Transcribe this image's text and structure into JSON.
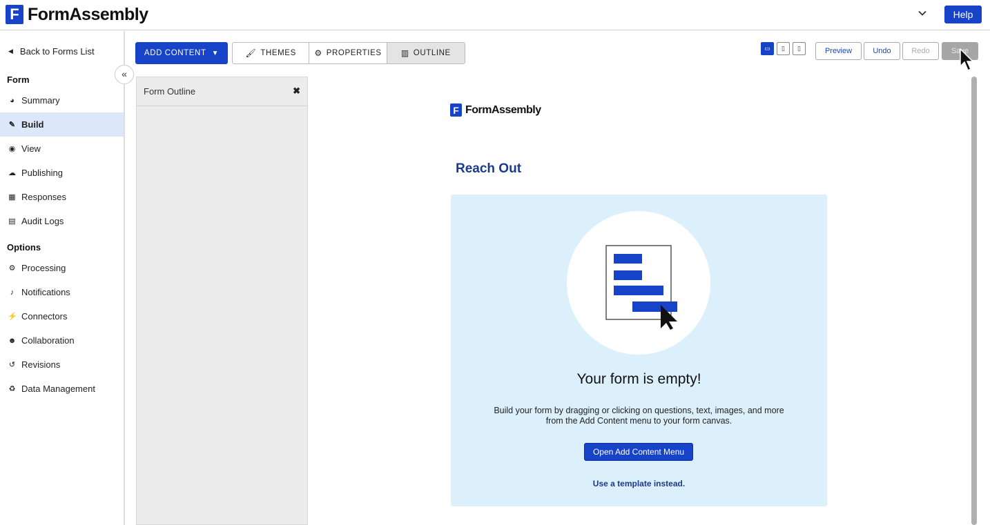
{
  "app": {
    "logo_letter": "F",
    "name": "FormAssembly",
    "help_label": "Help"
  },
  "sidebar": {
    "back_label": "Back to Forms List",
    "form_heading": "Form",
    "form_items": [
      {
        "label": "Summary",
        "icon": "dashboard-icon"
      },
      {
        "label": "Build",
        "icon": "pencil-icon",
        "active": true
      },
      {
        "label": "View",
        "icon": "eye-icon"
      },
      {
        "label": "Publishing",
        "icon": "cloud-upload-icon"
      },
      {
        "label": "Responses",
        "icon": "table-icon"
      },
      {
        "label": "Audit Logs",
        "icon": "file-icon"
      }
    ],
    "options_heading": "Options",
    "option_items": [
      {
        "label": "Processing",
        "icon": "cogs-icon"
      },
      {
        "label": "Notifications",
        "icon": "bell-icon"
      },
      {
        "label": "Connectors",
        "icon": "plug-icon"
      },
      {
        "label": "Collaboration",
        "icon": "users-icon"
      },
      {
        "label": "Revisions",
        "icon": "history-icon"
      },
      {
        "label": "Data Management",
        "icon": "recycle-icon"
      }
    ]
  },
  "toolbar": {
    "add_content": "ADD CONTENT",
    "themes": "THEMES",
    "properties": "PROPERTIES",
    "outline": "OUTLINE",
    "preview": "Preview",
    "undo": "Undo",
    "redo": "Redo",
    "save": "Save"
  },
  "outline_panel": {
    "title": "Form Outline"
  },
  "canvas": {
    "logo_letter": "F",
    "logo_name": "FormAssembly",
    "form_title": "Reach Out",
    "empty_title": "Your form is empty!",
    "empty_desc": "Build your form by dragging or clicking on questions, text, images, and more from the Add Content menu to your form canvas.",
    "open_button": "Open Add Content Menu",
    "template_link": "Use a template instead."
  },
  "colors": {
    "brand": "#1643c7",
    "active_bg": "#dce8fa",
    "empty_bg": "#dcf0fc",
    "title": "#1a3a8f"
  }
}
